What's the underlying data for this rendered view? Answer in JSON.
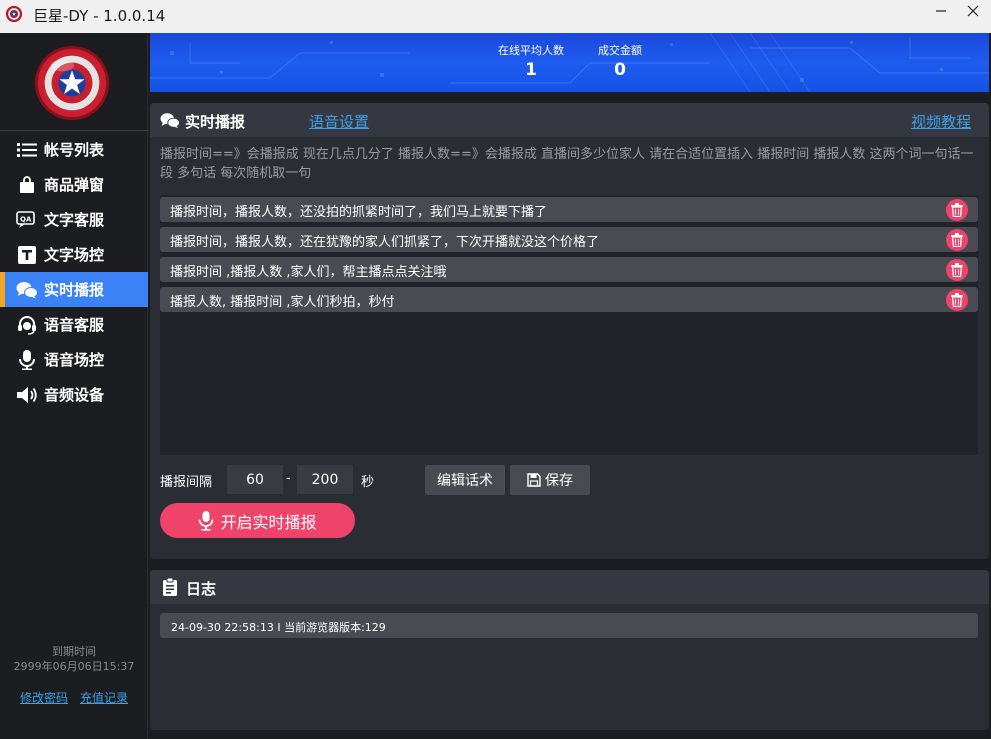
{
  "window": {
    "title": "巨星-DY - 1.0.0.14"
  },
  "sidebar": {
    "items": [
      {
        "label": "帐号列表",
        "icon": "list-icon"
      },
      {
        "label": "商品弹窗",
        "icon": "shopping-bag-icon"
      },
      {
        "label": "文字客服",
        "icon": "chat-qa-icon"
      },
      {
        "label": "文字场控",
        "icon": "text-t-icon"
      },
      {
        "label": "实时播报",
        "icon": "wechat-bubbles-icon"
      },
      {
        "label": "语音客服",
        "icon": "headset-icon"
      },
      {
        "label": "语音场控",
        "icon": "microphone-icon"
      },
      {
        "label": "音频设备",
        "icon": "speaker-icon"
      }
    ],
    "active_index": 4,
    "expire_label": "到期时间",
    "expire_value": "2999年06月06日15:37",
    "change_password": "修改密码",
    "recharge_records": "充值记录"
  },
  "banner": {
    "online_label": "在线平均人数",
    "online_value": "1",
    "deal_label": "成交金额",
    "deal_value": "0"
  },
  "broadcast": {
    "title": "实时播报",
    "voice_settings": "语音设置",
    "video_tutorial": "视频教程",
    "hint": "播报时间==》会播报成 现在几点几分了 播报人数==》会播报成 直播间多少位家人 请在合适位置插入 播报时间 播报人数 这两个词一句话一段 多句话 每次随机取一句",
    "scripts": [
      "播报时间，播报人数，还没拍的抓紧时间了，我们马上就要下播了",
      "播报时间，播报人数，还在犹豫的家人们抓紧了，下次开播就没这个价格了",
      "播报时间 ,播报人数 ,家人们，帮主播点点关注哦",
      "播报人数, 播报时间 ,家人们秒拍，秒付"
    ],
    "interval_label": "播报间隔",
    "interval_min": "60",
    "interval_dash": "-",
    "interval_max": "200",
    "interval_unit": "秒",
    "edit_button": "编辑话术",
    "save_button": "保存",
    "start_button": "开启实时播报"
  },
  "log": {
    "title": "日志",
    "entries": [
      "24-09-30 22:58:13 I  当前游览器版本:129"
    ]
  },
  "colors": {
    "accent_blue": "#3b82f6",
    "accent_pink": "#f0436a",
    "link_blue": "#3aa0e8",
    "active_marker": "#f5a623"
  }
}
